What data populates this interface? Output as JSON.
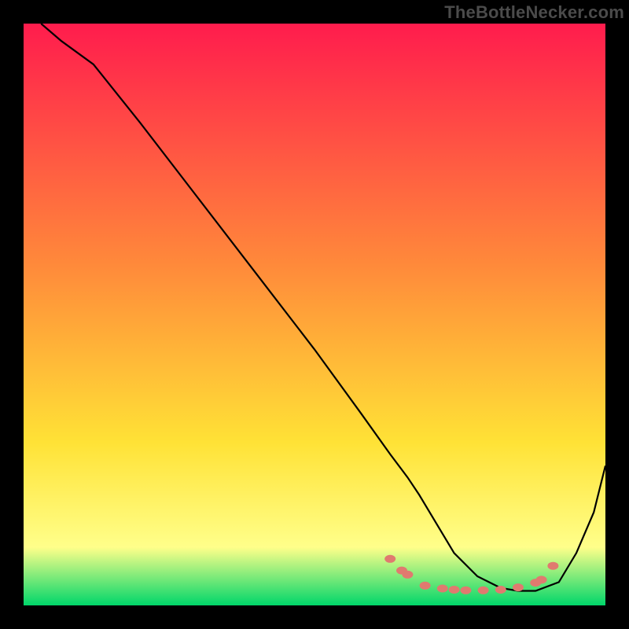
{
  "watermark": "TheBottleNecker.com",
  "chart_data": {
    "type": "line",
    "title": "",
    "xlabel": "",
    "ylabel": "",
    "xlim": [
      0,
      100
    ],
    "ylim": [
      0,
      100
    ],
    "grid": false,
    "legend": false,
    "background_gradient": {
      "top": "#ff1c4d",
      "mid1": "#ff8b3a",
      "mid2": "#ffe236",
      "mid3": "#ffff8a",
      "bottom": "#00d66a"
    },
    "series": [
      {
        "name": "curve",
        "stroke": "#000000",
        "x": [
          3,
          6.5,
          12,
          20,
          30,
          40,
          50,
          58,
          63,
          66,
          68,
          71,
          74,
          78,
          82,
          85,
          88,
          92,
          95,
          98,
          100
        ],
        "y": [
          100,
          97,
          93,
          83,
          70,
          57,
          44,
          33,
          26,
          22,
          19,
          14,
          9,
          5,
          3,
          2.5,
          2.5,
          4,
          9,
          16,
          24
        ]
      }
    ],
    "markers": {
      "name": "dots",
      "color": "#e07a6f",
      "points": [
        {
          "x": 63,
          "y": 8
        },
        {
          "x": 65,
          "y": 6
        },
        {
          "x": 66,
          "y": 5.3
        },
        {
          "x": 69,
          "y": 3.4
        },
        {
          "x": 72,
          "y": 2.9
        },
        {
          "x": 74,
          "y": 2.7
        },
        {
          "x": 76,
          "y": 2.6
        },
        {
          "x": 79,
          "y": 2.6
        },
        {
          "x": 82,
          "y": 2.7
        },
        {
          "x": 85,
          "y": 3.1
        },
        {
          "x": 88,
          "y": 3.9
        },
        {
          "x": 89,
          "y": 4.4
        },
        {
          "x": 91,
          "y": 6.8
        }
      ]
    }
  }
}
